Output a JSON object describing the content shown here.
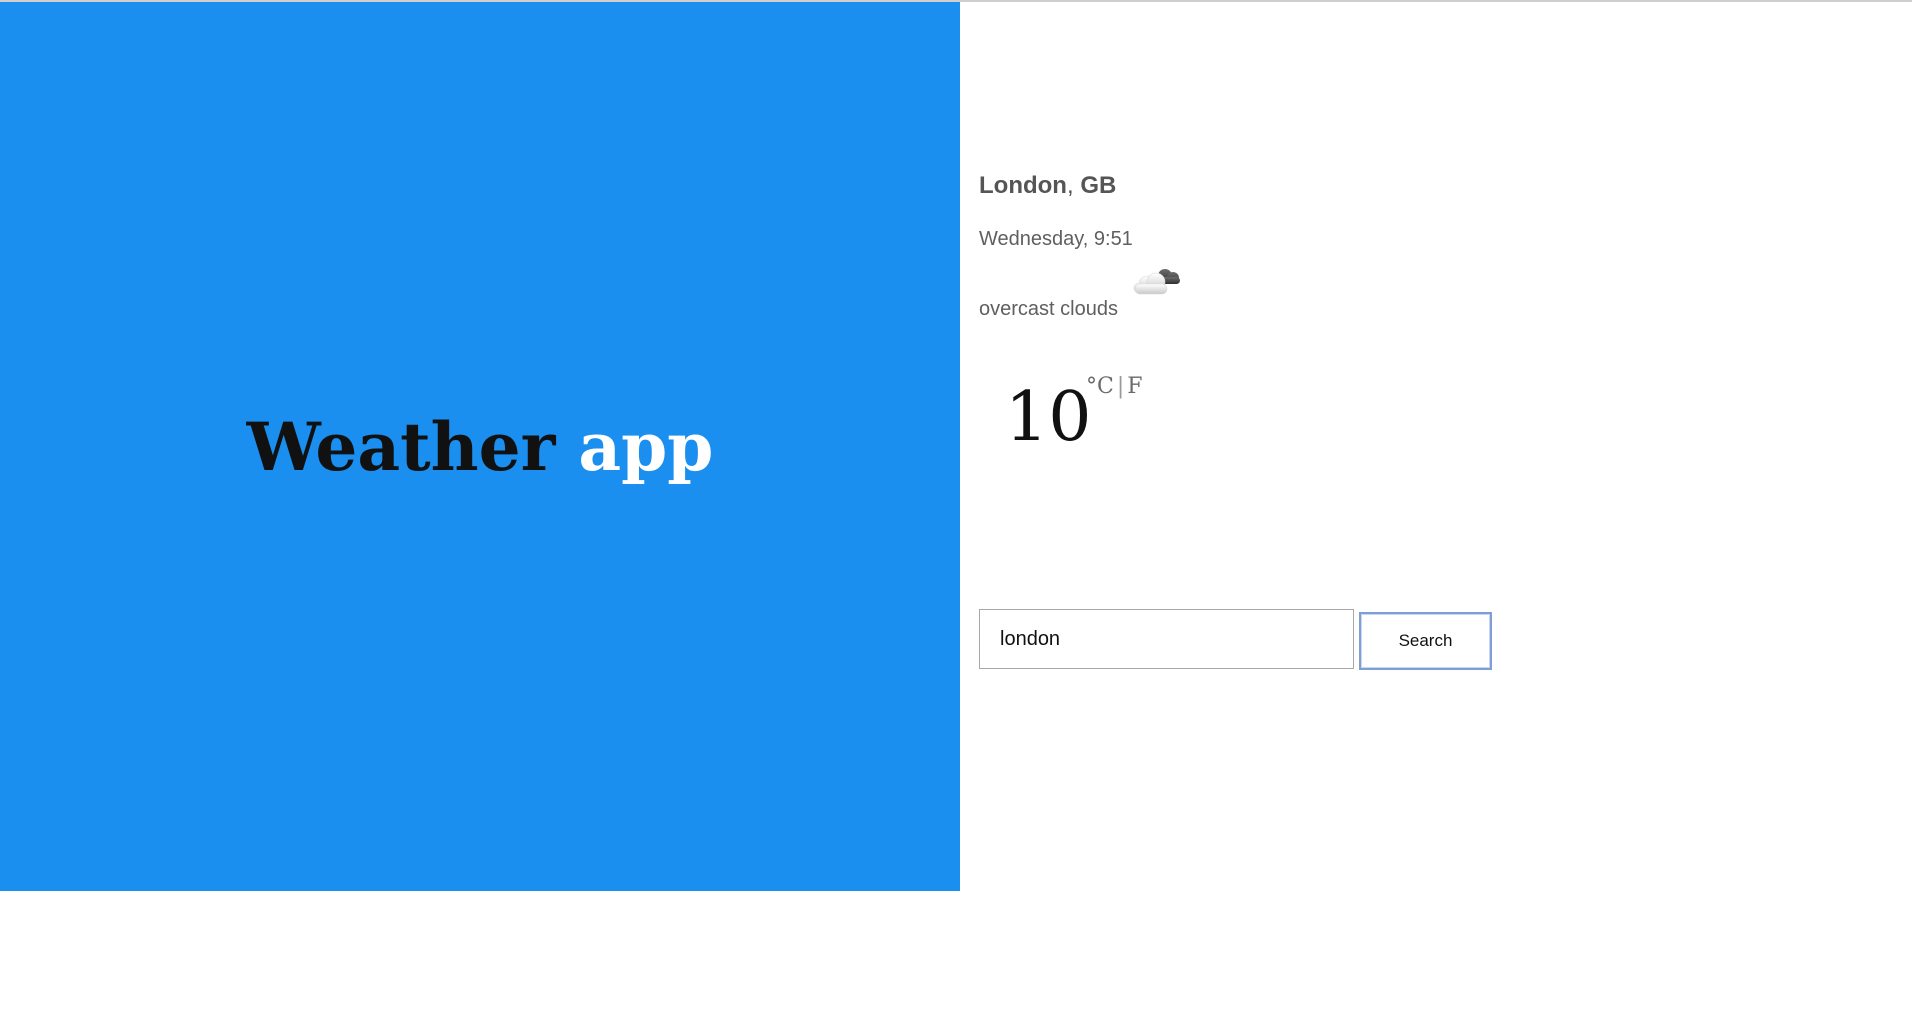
{
  "hero": {
    "title_word1": "Weather",
    "title_word2": "app",
    "background_color": "#1a8fef"
  },
  "weather": {
    "city": "London",
    "separator": ",",
    "country": "GB",
    "day_time": "Wednesday, 9:51",
    "description": "overcast clouds",
    "icon": "cloud-icon",
    "temperature": "10",
    "unit_celsius": "°C",
    "unit_separator": "|",
    "unit_fahrenheit": "F"
  },
  "search": {
    "input_value": "london",
    "button_label": "Search"
  }
}
